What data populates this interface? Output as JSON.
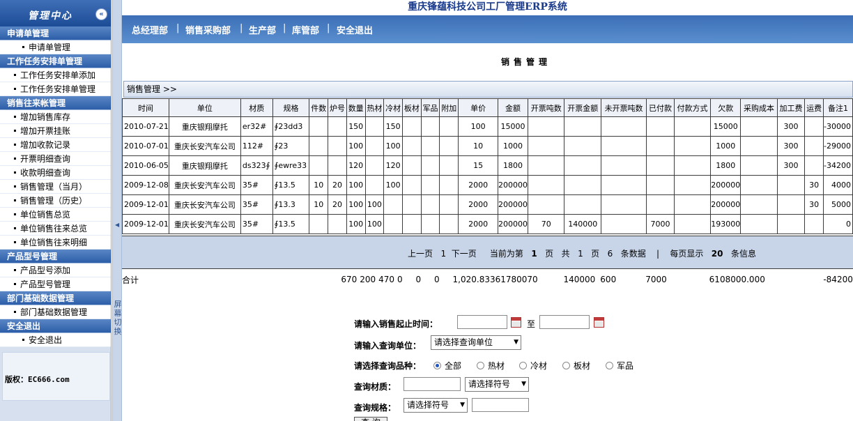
{
  "sidebar": {
    "title": "管理中心",
    "collapse_glyph": "«",
    "groups": [
      {
        "title": "申请单管理",
        "items": [
          "申请单管理"
        ]
      },
      {
        "title": "工作任务安排单管理",
        "items": [
          "工作任务安排单添加",
          "工作任务安排单管理"
        ]
      },
      {
        "title": "销售往来帐管理",
        "items": [
          "增加销售库存",
          "增加开票挂账",
          "增加收款记录",
          "开票明细查询",
          "收款明细查询",
          "销售管理（当月）",
          "销售管理（历史）",
          "单位销售总览",
          "单位销售往来总览",
          "单位销售往来明细"
        ]
      },
      {
        "title": "产品型号管理",
        "items": [
          "产品型号添加",
          "产品型号管理"
        ]
      },
      {
        "title": "部门基础数据管理",
        "items": [
          "部门基础数据管理"
        ]
      },
      {
        "title": "安全退出",
        "items": [
          "安全退出"
        ]
      }
    ],
    "copyright": "版权：EC666.com",
    "splitter_label": "屏幕切换"
  },
  "header": {
    "app_title": "重庆锋蕴科技公司工厂管理ERP系统",
    "nav": [
      "总经理部",
      "销售采购部",
      "生产部",
      "库管部",
      "安全退出"
    ]
  },
  "page": {
    "title": "销售管理",
    "breadcrumb": "销售管理 >>"
  },
  "table": {
    "columns": [
      "时间",
      "单位",
      "材质",
      "规格",
      "件数",
      "炉号",
      "数量",
      "热材",
      "冷材",
      "板材",
      "军品",
      "附加",
      "单价",
      "金额",
      "开票吨数",
      "开票金额",
      "未开票吨数",
      "已付款",
      "付款方式",
      "欠款",
      "采购成本",
      "加工费",
      "运费",
      "备注1"
    ],
    "rows": [
      [
        "2010-07-21",
        "重庆银翔摩托",
        "er32#",
        "∮23dd3",
        "",
        "",
        "150",
        "",
        "150",
        "",
        "",
        "",
        "100",
        "15000",
        "",
        "",
        "",
        "",
        "",
        "15000",
        "",
        "300",
        "",
        "-30000"
      ],
      [
        "2010-07-01",
        "重庆长安汽车公司",
        "112#",
        "∮23",
        "",
        "",
        "100",
        "",
        "100",
        "",
        "",
        "",
        "10",
        "1000",
        "",
        "",
        "",
        "",
        "",
        "1000",
        "",
        "300",
        "",
        "-29000"
      ],
      [
        "2010-06-05",
        "重庆银翔摩托",
        "ds323∮",
        "∮ewre33",
        "",
        "",
        "120",
        "",
        "120",
        "",
        "",
        "",
        "15",
        "1800",
        "",
        "",
        "",
        "",
        "",
        "1800",
        "",
        "300",
        "",
        "-34200"
      ],
      [
        "2009-12-08",
        "重庆长安汽车公司",
        "35#",
        "∮13.5",
        "10",
        "20",
        "100",
        "",
        "100",
        "",
        "",
        "",
        "2000",
        "200000",
        "",
        "",
        "",
        "",
        "",
        "200000",
        "",
        "",
        "30",
        "4000"
      ],
      [
        "2009-12-01",
        "重庆长安汽车公司",
        "35#",
        "∮13.3",
        "10",
        "20",
        "100",
        "100",
        "",
        "",
        "",
        "",
        "2000",
        "200000",
        "",
        "",
        "",
        "",
        "",
        "200000",
        "",
        "",
        "30",
        "5000"
      ],
      [
        "2009-12-01",
        "重庆长安汽车公司",
        "35#",
        "∮13.5",
        "",
        "",
        "100",
        "100",
        "",
        "",
        "",
        "",
        "2000",
        "200000",
        "70",
        "140000",
        "",
        "7000",
        "",
        "193000",
        "",
        "",
        "",
        "0"
      ]
    ],
    "total": [
      "合计",
      "",
      "",
      "",
      "",
      "",
      "670",
      "200",
      "470",
      "0",
      "0",
      "0",
      "1,020.833",
      "617800",
      "70",
      "140000",
      "600",
      "7000",
      "",
      "610800",
      "0.000",
      "",
      "",
      "-84200"
    ]
  },
  "pager": {
    "prev": "上一页",
    "page_num": "1",
    "next": "下一页",
    "current_prefix": "当前为第",
    "current": "1",
    "page_word": "页",
    "total_prefix": "共",
    "total_pages": "1",
    "page_word2": "页",
    "records": "6",
    "records_suffix": "条数据",
    "divider": "|",
    "per_page_prefix": "每页显示",
    "per_page": "20",
    "per_page_suffix": "条信息"
  },
  "search": {
    "date_label": "请输入销售起止时间：",
    "to": "至",
    "unit_label": "请输入查询单位：",
    "unit_select": "请选择查询单位",
    "kind_label": "请选择查询品种：",
    "kinds": [
      "全部",
      "热材",
      "冷材",
      "板材",
      "军品"
    ],
    "kind_selected": "全部",
    "material_label": "查询材质：",
    "material_select": "请选择符号",
    "spec_label": "查询规格：",
    "spec_select": "请选择符号",
    "query_button": "查 询"
  }
}
